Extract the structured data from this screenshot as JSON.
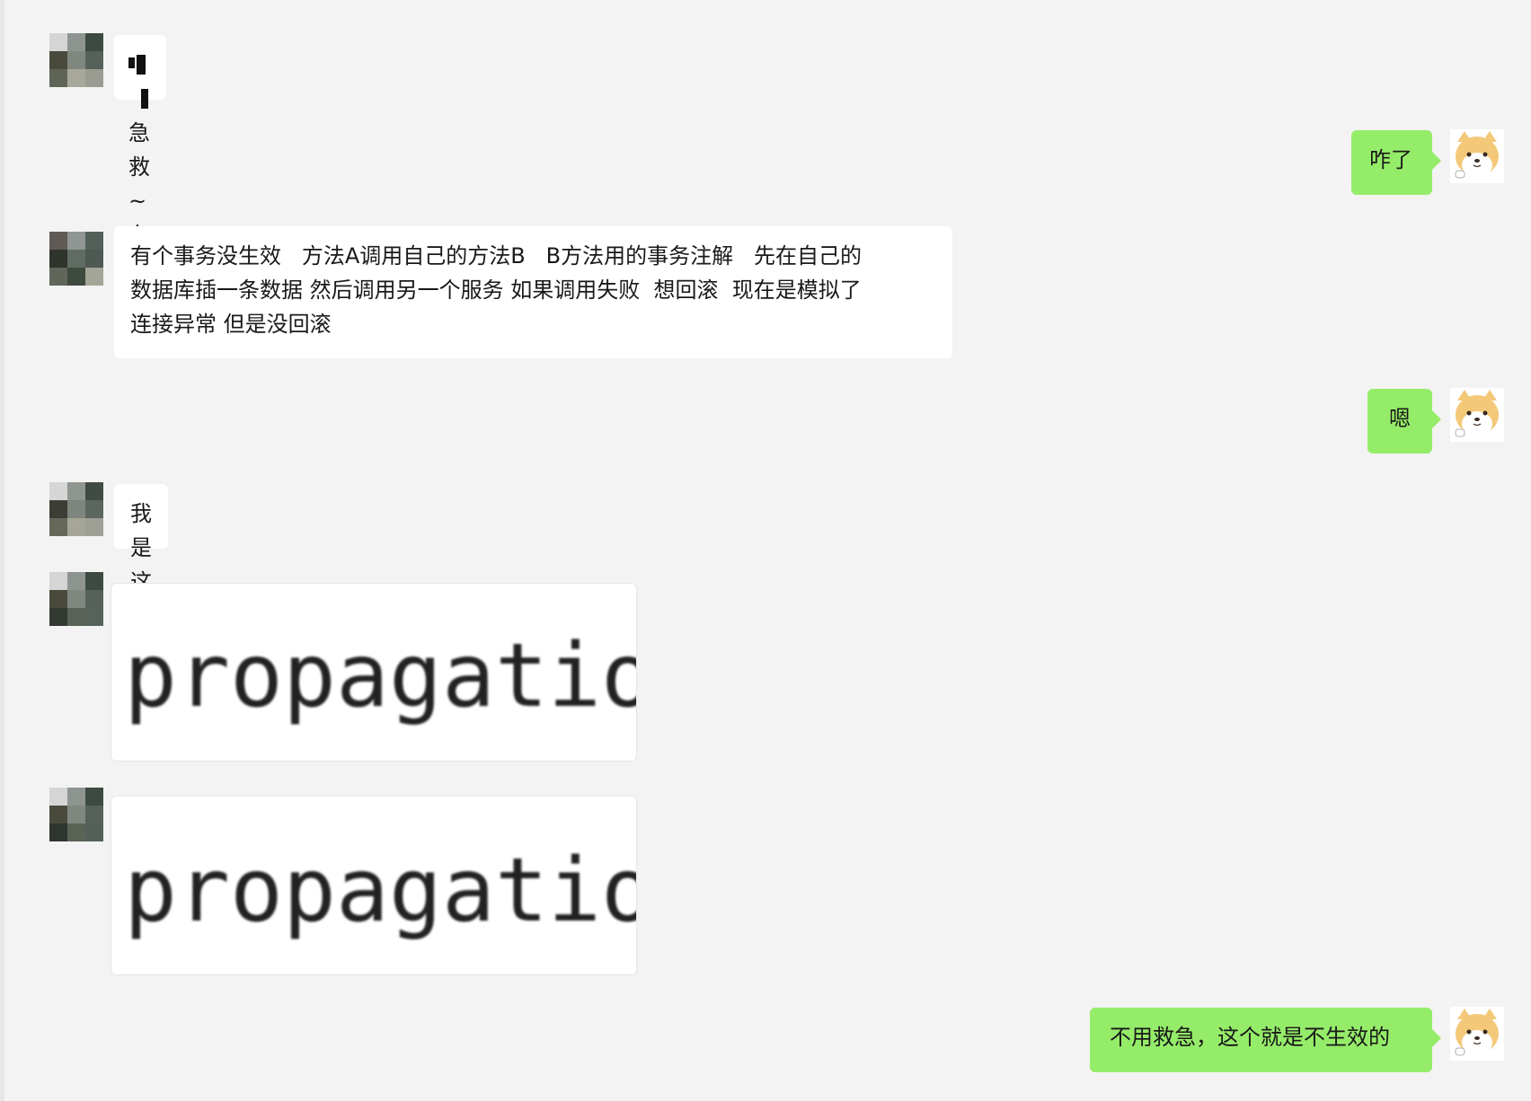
{
  "messages": [
    {
      "side": "left",
      "text": "急救~有空不"
    },
    {
      "side": "right",
      "text": "咋了"
    },
    {
      "side": "left",
      "lines": [
        "有个事务没生效   方法A调用自己的方法B   B方法用的事务注解   先在自己的",
        "数据库插一条数据 然后调用另一个服务 如果调用失败  想回滚  现在是模拟了",
        "连接异常 但是没回滚"
      ]
    },
    {
      "side": "right",
      "text": "嗯"
    },
    {
      "side": "left",
      "text": "我是这么写的"
    },
    {
      "side": "left",
      "type": "image",
      "text": "propagatio"
    },
    {
      "side": "left",
      "type": "image",
      "text": "propagatio"
    },
    {
      "side": "right",
      "text": "不用救急，这个就是不生效的"
    }
  ],
  "colors": {
    "background": "#f3f3f3",
    "incoming_bubble": "#ffffff",
    "outgoing_bubble": "#95ec69"
  },
  "icons": {
    "left_avatar": "pixelated-avatar",
    "right_avatar": "shiba-dog-avatar"
  }
}
